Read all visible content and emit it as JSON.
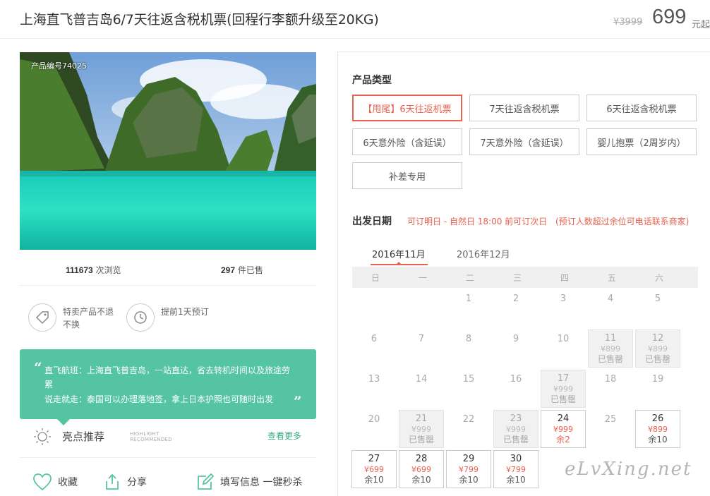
{
  "header": {
    "title": "上海直飞普吉岛6/7天往返含税机票(回程行李额升级至20KG)",
    "original_price": "¥3999",
    "price": "699",
    "price_unit": "元起"
  },
  "product": {
    "image_label": "产品编号74025",
    "views_count": "111673",
    "views_label": "次浏览",
    "sold_count": "297",
    "sold_label": "件已售"
  },
  "features": [
    {
      "icon": "tag-icon",
      "label": "特卖产品不退不换"
    },
    {
      "icon": "clock-icon",
      "label": "提前1天预订"
    }
  ],
  "highlights": {
    "line1": "直飞航班：上海直飞普吉岛，一站直达，省去转机时间以及旅途劳累",
    "line2": "说走就走：泰国可以办理落地签，拿上日本护照也可随时出发",
    "title": "亮点推荐",
    "title_en_1": "HIGHLIGHT",
    "title_en_2": "RECOMMENDED",
    "more": "查看更多"
  },
  "actions": {
    "favorite": "收藏",
    "share": "分享",
    "fill": "填写信息 一键秒杀"
  },
  "booking": {
    "type_title": "产品类型",
    "types": [
      "【甩尾】6天往返机票",
      "7天往返含税机票",
      "6天往返含税机票",
      "6天意外险（含延误）",
      "7天意外险（含延误）",
      "婴儿抱票（2周岁内）",
      "补差专用"
    ],
    "selected_type_index": 0,
    "date_title": "出发日期",
    "note1": "可订明日 - 自然日 18:00 前可订次日",
    "note2": "(预订人数超过余位可电话联系商家)",
    "months": [
      "2016年11月",
      "2016年12月"
    ],
    "active_month_index": 0,
    "weekdays": [
      "日",
      "一",
      "二",
      "三",
      "四",
      "五",
      "六"
    ],
    "days": [
      {
        "day": "1",
        "col": 2,
        "row": 0
      },
      {
        "day": "2",
        "col": 3,
        "row": 0
      },
      {
        "day": "3",
        "col": 4,
        "row": 0
      },
      {
        "day": "4",
        "col": 5,
        "row": 0
      },
      {
        "day": "5",
        "col": 6,
        "row": 0
      },
      {
        "day": "6",
        "col": 0,
        "row": 1
      },
      {
        "day": "7",
        "col": 1,
        "row": 1
      },
      {
        "day": "8",
        "col": 2,
        "row": 1
      },
      {
        "day": "9",
        "col": 3,
        "row": 1
      },
      {
        "day": "10",
        "col": 4,
        "row": 1
      },
      {
        "day": "11",
        "col": 5,
        "row": 1,
        "state": "sold",
        "price": "¥899",
        "status": "已售罄"
      },
      {
        "day": "12",
        "col": 6,
        "row": 1,
        "state": "sold",
        "price": "¥899",
        "status": "已售罄"
      },
      {
        "day": "13",
        "col": 0,
        "row": 2
      },
      {
        "day": "14",
        "col": 1,
        "row": 2
      },
      {
        "day": "15",
        "col": 2,
        "row": 2
      },
      {
        "day": "16",
        "col": 3,
        "row": 2
      },
      {
        "day": "17",
        "col": 4,
        "row": 2,
        "state": "sold",
        "price": "¥999",
        "status": "已售罄"
      },
      {
        "day": "18",
        "col": 5,
        "row": 2
      },
      {
        "day": "19",
        "col": 6,
        "row": 2
      },
      {
        "day": "20",
        "col": 0,
        "row": 3
      },
      {
        "day": "21",
        "col": 1,
        "row": 3,
        "state": "sold",
        "price": "¥999",
        "status": "已售罄"
      },
      {
        "day": "22",
        "col": 2,
        "row": 3
      },
      {
        "day": "23",
        "col": 3,
        "row": 3,
        "state": "sold",
        "price": "¥999",
        "status": "已售罄"
      },
      {
        "day": "24",
        "col": 4,
        "row": 3,
        "state": "low",
        "price": "¥999",
        "status": "余2"
      },
      {
        "day": "25",
        "col": 5,
        "row": 3
      },
      {
        "day": "26",
        "col": 6,
        "row": 3,
        "state": "avail",
        "price": "¥899",
        "status": "余10"
      },
      {
        "day": "27",
        "col": 0,
        "row": 4,
        "state": "avail",
        "price": "¥699",
        "status": "余10"
      },
      {
        "day": "28",
        "col": 1,
        "row": 4,
        "state": "avail",
        "price": "¥699",
        "status": "余10"
      },
      {
        "day": "29",
        "col": 2,
        "row": 4,
        "state": "avail",
        "price": "¥799",
        "status": "余10"
      },
      {
        "day": "30",
        "col": 3,
        "row": 4,
        "state": "avail",
        "price": "¥799",
        "status": "余10"
      }
    ]
  },
  "watermark": "eLvXing.net",
  "colors": {
    "accent": "#e8624e",
    "green": "#55c4a3"
  }
}
